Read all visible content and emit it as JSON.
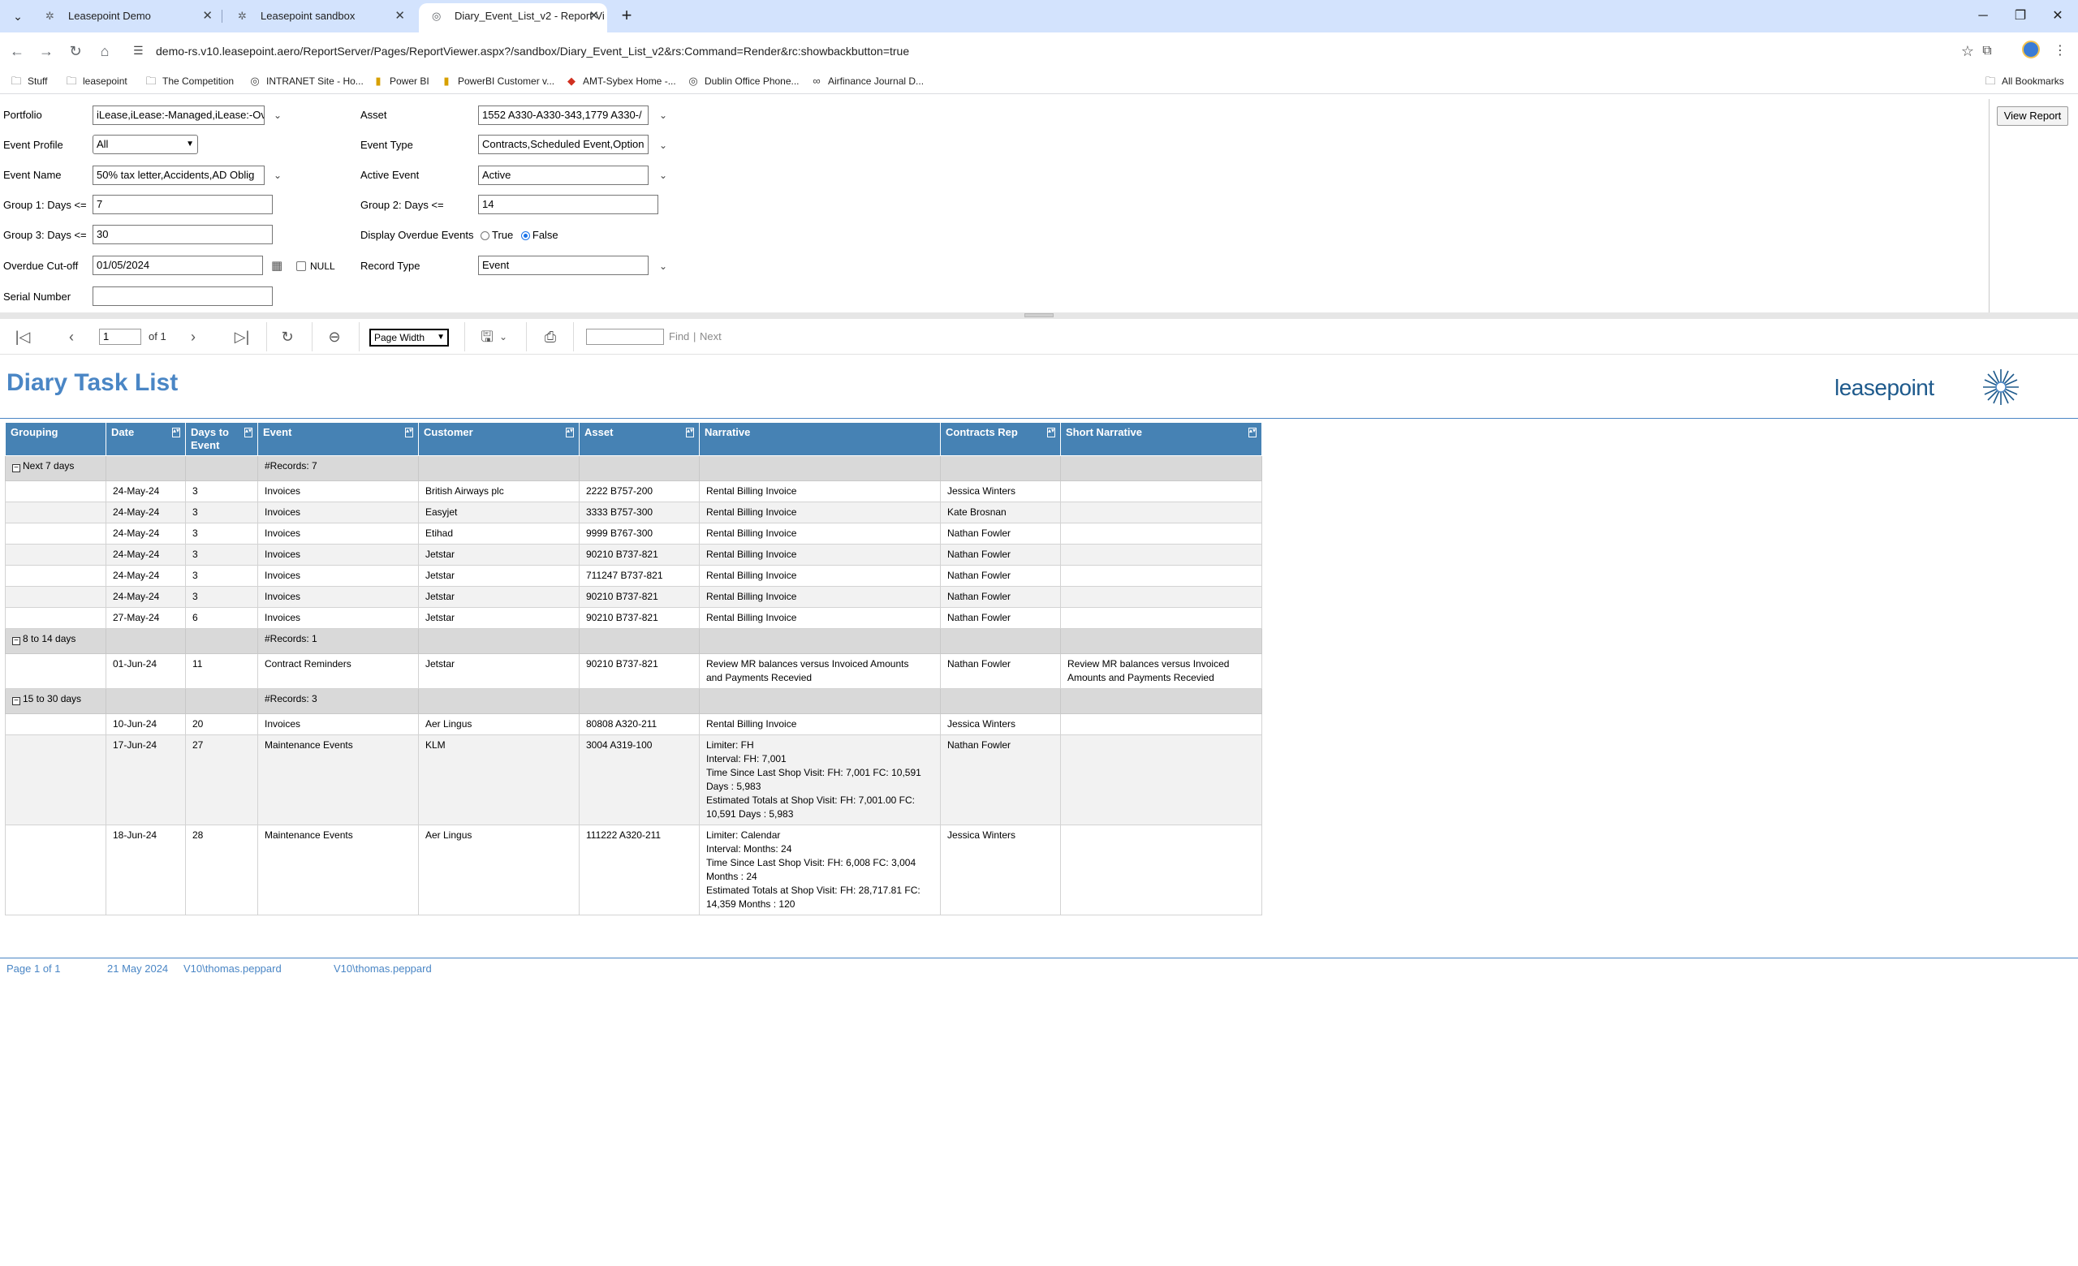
{
  "browser": {
    "tabs": [
      {
        "title": "Leasepoint Demo",
        "active": false
      },
      {
        "title": "Leasepoint sandbox",
        "active": false
      },
      {
        "title": "Diary_Event_List_v2 - Report Vi",
        "active": true
      }
    ],
    "new_tab_symbol": "+",
    "url": "demo-rs.v10.leasepoint.aero/ReportServer/Pages/ReportViewer.aspx?/sandbox/Diary_Event_List_v2&rs:Command=Render&rc:showbackbutton=true",
    "bookmarks": [
      {
        "label": "Stuff",
        "icon": "folder-icon"
      },
      {
        "label": "leasepoint",
        "icon": "folder-icon"
      },
      {
        "label": "The Competition",
        "icon": "folder-icon"
      },
      {
        "label": "INTRANET Site - Ho...",
        "icon": "globe-icon"
      },
      {
        "label": "Power BI",
        "icon": "powerbi-icon"
      },
      {
        "label": "PowerBI Customer v...",
        "icon": "powerbi-icon"
      },
      {
        "label": "AMT-Sybex Home -...",
        "icon": "amt-icon"
      },
      {
        "label": "Dublin Office Phone...",
        "icon": "globe-icon"
      },
      {
        "label": "Airfinance Journal D...",
        "icon": "link-icon"
      }
    ],
    "all_bookmarks": "All Bookmarks"
  },
  "params": {
    "portfolio": {
      "label": "Portfolio",
      "value": "iLease,iLease:-Managed,iLease:-Ov"
    },
    "event_profile": {
      "label": "Event Profile",
      "value": "All"
    },
    "event_name": {
      "label": "Event Name",
      "value": "50% tax letter,Accidents,AD Oblig"
    },
    "group1": {
      "label": "Group 1: Days <=",
      "value": "7"
    },
    "group3": {
      "label": "Group 3: Days <=",
      "value": "30"
    },
    "overdue_cutoff": {
      "label": "Overdue Cut-off",
      "value": "01/05/2024",
      "null_label": "NULL"
    },
    "serial_number": {
      "label": "Serial Number",
      "value": ""
    },
    "asset": {
      "label": "Asset",
      "value": "1552 A330-A330-343,1779 A330-/"
    },
    "event_type": {
      "label": "Event Type",
      "value": "Contracts,Scheduled Event,Option"
    },
    "active_event": {
      "label": "Active Event",
      "value": "Active"
    },
    "group2": {
      "label": "Group 2: Days <=",
      "value": "14"
    },
    "display_overdue": {
      "label": "Display Overdue Events",
      "true_label": "True",
      "false_label": "False",
      "selected": "False"
    },
    "record_type": {
      "label": "Record Type",
      "value": "Event"
    },
    "view_report": "View Report"
  },
  "report_toolbar": {
    "page": "1",
    "of": "of 1",
    "zoom": "Page Width",
    "find": "Find",
    "next": "Next",
    "separator": "|"
  },
  "report": {
    "title": "Diary Task List",
    "logo_text": "leasepoint",
    "columns": [
      "Grouping",
      "Date",
      "Days to Event",
      "Event",
      "Customer",
      "Asset",
      "Narrative",
      "Contracts Rep",
      "Short Narrative"
    ],
    "groups": [
      {
        "label": "Next 7 days",
        "records": "#Records: 7",
        "rows": [
          {
            "date": "24-May-24",
            "days": "3",
            "event": "Invoices",
            "customer": "British Airways plc",
            "asset": "2222 B757-200",
            "narrative": [
              "Rental Billing Invoice"
            ],
            "rep": "Jessica Winters",
            "short": []
          },
          {
            "date": "24-May-24",
            "days": "3",
            "event": "Invoices",
            "customer": "Easyjet",
            "asset": "3333 B757-300",
            "narrative": [
              "Rental Billing Invoice"
            ],
            "rep": "Kate Brosnan",
            "short": []
          },
          {
            "date": "24-May-24",
            "days": "3",
            "event": "Invoices",
            "customer": "Etihad",
            "asset": "9999 B767-300",
            "narrative": [
              "Rental Billing Invoice"
            ],
            "rep": "Nathan Fowler",
            "short": []
          },
          {
            "date": "24-May-24",
            "days": "3",
            "event": "Invoices",
            "customer": "Jetstar",
            "asset": "90210 B737-821",
            "narrative": [
              "Rental Billing Invoice"
            ],
            "rep": "Nathan Fowler",
            "short": []
          },
          {
            "date": "24-May-24",
            "days": "3",
            "event": "Invoices",
            "customer": "Jetstar",
            "asset": "711247 B737-821",
            "narrative": [
              "Rental Billing Invoice"
            ],
            "rep": "Nathan Fowler",
            "short": []
          },
          {
            "date": "24-May-24",
            "days": "3",
            "event": "Invoices",
            "customer": "Jetstar",
            "asset": "90210 B737-821",
            "narrative": [
              "Rental Billing Invoice"
            ],
            "rep": "Nathan Fowler",
            "short": []
          },
          {
            "date": "27-May-24",
            "days": "6",
            "event": "Invoices",
            "customer": "Jetstar",
            "asset": "90210 B737-821",
            "narrative": [
              "Rental Billing Invoice"
            ],
            "rep": "Nathan Fowler",
            "short": []
          }
        ]
      },
      {
        "label": "8 to 14 days",
        "records": "#Records: 1",
        "rows": [
          {
            "date": "01-Jun-24",
            "days": "11",
            "event": "Contract Reminders",
            "customer": "Jetstar",
            "asset": "90210 B737-821",
            "narrative": [
              "Review MR balances versus Invoiced Amounts",
              "and Payments Recevied"
            ],
            "rep": "Nathan Fowler",
            "short": [
              "Review MR balances versus Invoiced",
              "Amounts and Payments Recevied"
            ]
          }
        ]
      },
      {
        "label": "15 to 30 days",
        "records": "#Records: 3",
        "rows": [
          {
            "date": "10-Jun-24",
            "days": "20",
            "event": "Invoices",
            "customer": "Aer Lingus",
            "asset": "80808 A320-211",
            "narrative": [
              "Rental Billing Invoice"
            ],
            "rep": "Jessica Winters",
            "short": []
          },
          {
            "date": "17-Jun-24",
            "days": "27",
            "event": "Maintenance Events",
            "customer": "KLM",
            "asset": "3004 A319-100",
            "narrative": [
              "Limiter: FH",
              "Interval: FH: 7,001",
              "Time Since Last Shop Visit: FH: 7,001 FC: 10,591",
              "Days : 5,983",
              "Estimated Totals at Shop Visit: FH: 7,001.00 FC:",
              "10,591 Days : 5,983"
            ],
            "rep": "Nathan Fowler",
            "short": []
          },
          {
            "date": "18-Jun-24",
            "days": "28",
            "event": "Maintenance Events",
            "customer": "Aer Lingus",
            "asset": "111222 A320-211",
            "narrative": [
              "Limiter: Calendar",
              "Interval: Months: 24",
              "Time Since Last Shop Visit: FH: 6,008 FC: 3,004",
              "Months : 24",
              "Estimated Totals at Shop Visit: FH: 28,717.81 FC:",
              "14,359 Months : 120"
            ],
            "rep": "Jessica Winters",
            "short": []
          }
        ]
      }
    ],
    "footer": {
      "page": "Page 1 of 1",
      "date": "21 May 2024",
      "user1": "V10\\thomas.peppard",
      "user2": "V10\\thomas.peppard"
    }
  }
}
